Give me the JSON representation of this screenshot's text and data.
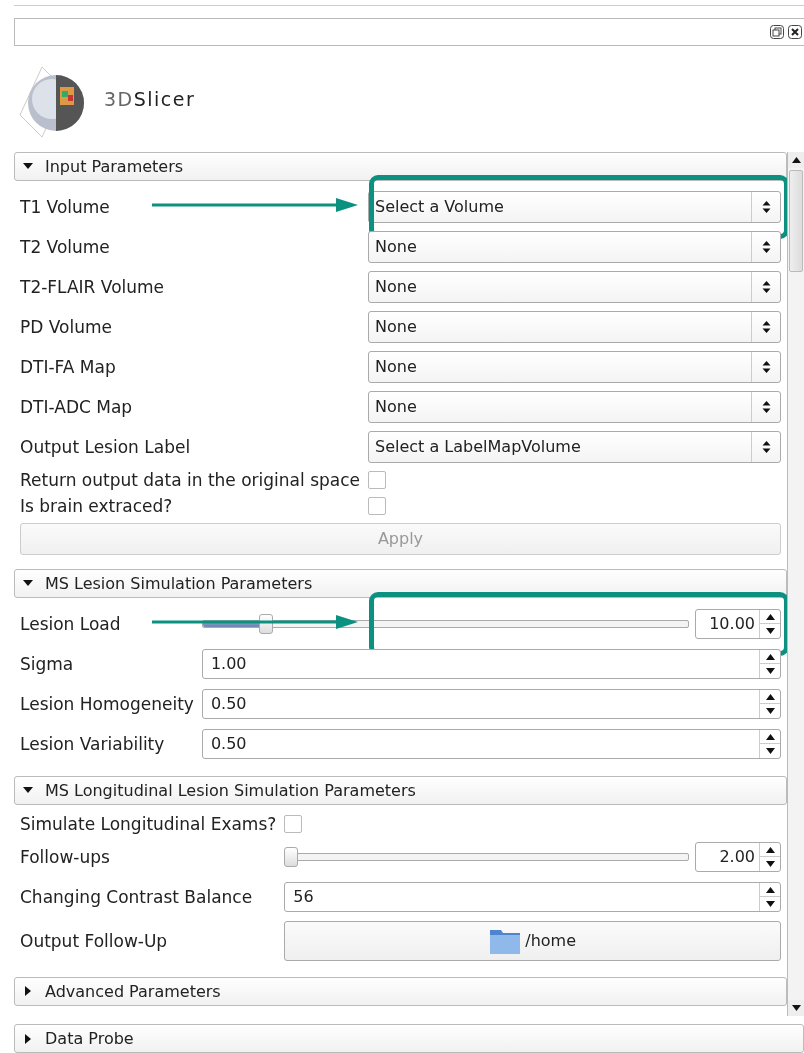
{
  "logo": {
    "prefix": "3D",
    "name": "Slicer"
  },
  "sections": [
    {
      "title": "Input Parameters",
      "expanded": true,
      "rows": [
        {
          "kind": "combo",
          "label": "T1 Volume",
          "value": "Select a Volume",
          "highlighted": true
        },
        {
          "kind": "combo",
          "label": "T2 Volume",
          "value": "None",
          "highlighted": false
        },
        {
          "kind": "combo",
          "label": "T2-FLAIR Volume",
          "value": "None",
          "highlighted": false
        },
        {
          "kind": "combo",
          "label": "PD Volume",
          "value": "None",
          "highlighted": false
        },
        {
          "kind": "combo",
          "label": "DTI-FA Map",
          "value": "None",
          "highlighted": false
        },
        {
          "kind": "combo",
          "label": "DTI-ADC Map",
          "value": "None",
          "highlighted": false
        },
        {
          "kind": "combo",
          "label": "Output Lesion Label",
          "value": "Select a LabelMapVolume",
          "highlighted": false
        },
        {
          "kind": "checkbox",
          "label": "Return output data in the original space",
          "checked": false
        },
        {
          "kind": "checkbox",
          "label": "Is brain extraced?",
          "checked": false
        },
        {
          "kind": "button",
          "label": "Apply",
          "disabled": true
        }
      ]
    },
    {
      "title": "MS Lesion Simulation Parameters",
      "expanded": true,
      "rows": [
        {
          "kind": "slider",
          "label": "Lesion Load",
          "value": "10.00",
          "level": 0.12,
          "highlighted": true
        },
        {
          "kind": "spin",
          "label": "Sigma",
          "value": "1.00"
        },
        {
          "kind": "spin",
          "label": "Lesion Homogeneity",
          "value": "0.50"
        },
        {
          "kind": "spin",
          "label": "Lesion Variability",
          "value": "0.50"
        }
      ]
    },
    {
      "title": "MS Longitudinal Lesion Simulation Parameters",
      "expanded": true,
      "rows": [
        {
          "kind": "checkbox",
          "label": "Simulate Longitudinal Exams?",
          "checked": false
        },
        {
          "kind": "slider",
          "label": "Follow-ups",
          "value": "2.00",
          "level": 0,
          "highlighted": false
        },
        {
          "kind": "spin",
          "label": "Changing Contrast Balance",
          "value": "56"
        },
        {
          "kind": "path",
          "label": "Output Follow-Up",
          "value": "/home"
        }
      ]
    },
    {
      "title": "Advanced Parameters",
      "expanded": false
    }
  ],
  "footer_section": {
    "title": "Data Probe",
    "expanded": false
  }
}
